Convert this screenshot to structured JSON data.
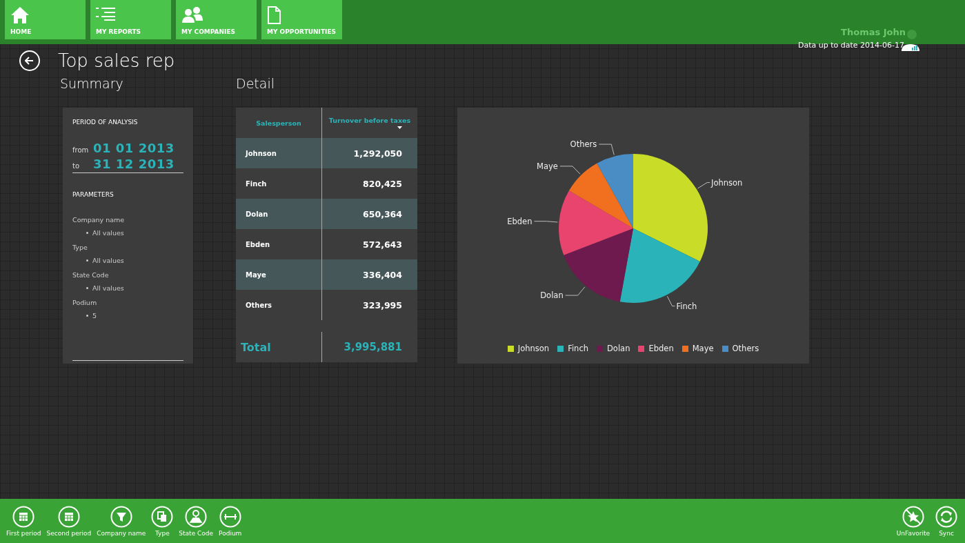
{
  "nav": [
    {
      "label": "HOME",
      "selected": false
    },
    {
      "label": "MY REPORTS",
      "selected": false
    },
    {
      "label": "MY COMPANIES",
      "selected": false
    },
    {
      "label": "MY OPPORTUNITIES",
      "selected": false
    }
  ],
  "user": {
    "name": "Thomas John",
    "status": "Data up to date 2014-06-17"
  },
  "page_title": "Top sales rep",
  "summary": {
    "heading": "Summary",
    "period_heading": "PERIOD OF ANALYSIS",
    "from_label": "from",
    "from_date": "01 01 2013",
    "to_label": "to",
    "to_date": "31 12 2013",
    "parameters_heading": "PARAMETERS",
    "parameters": [
      {
        "name": "Company name",
        "values": [
          "All values"
        ]
      },
      {
        "name": "Type",
        "values": [
          "All values"
        ]
      },
      {
        "name": "State Code",
        "values": [
          "All values"
        ]
      },
      {
        "name": "Podium",
        "values": [
          "5"
        ]
      }
    ]
  },
  "detail": {
    "heading": "Detail",
    "columns": [
      "Salesperson",
      "Turnover before taxes"
    ],
    "rows": [
      {
        "name": "Johnson",
        "value": "1,292,050"
      },
      {
        "name": "Finch",
        "value": "820,425"
      },
      {
        "name": "Dolan",
        "value": "650,364"
      },
      {
        "name": "Ebden",
        "value": "572,643"
      },
      {
        "name": "Maye",
        "value": "336,404"
      },
      {
        "name": "Others",
        "value": "323,995"
      }
    ],
    "total_label": "Total",
    "total_value": "3,995,881"
  },
  "chart": {
    "chart_data": {
      "type": "pie",
      "categories": [
        "Johnson",
        "Finch",
        "Dolan",
        "Ebden",
        "Maye",
        "Others"
      ],
      "values": [
        32.33,
        20.53,
        16.28,
        14.33,
        8.42,
        8.11
      ]
    },
    "legend": [
      {
        "label": "Johnson",
        "color": "#c8dc28"
      },
      {
        "label": "Finch",
        "color": "#2ab3b8"
      },
      {
        "label": "Dolan",
        "color": "#6e1a4e"
      },
      {
        "label": "Ebden",
        "color": "#e8446e"
      },
      {
        "label": "Maye",
        "color": "#f07020"
      },
      {
        "label": "Others",
        "color": "#4a8cc4"
      }
    ]
  },
  "app_bar_left": [
    {
      "label": "First period"
    },
    {
      "label": "Second period"
    },
    {
      "label": "Company name"
    },
    {
      "label": "Type"
    },
    {
      "label": "State Code"
    },
    {
      "label": "Podium"
    }
  ],
  "app_bar_right": [
    {
      "label": "UnFavorite"
    },
    {
      "label": "Sync"
    }
  ]
}
